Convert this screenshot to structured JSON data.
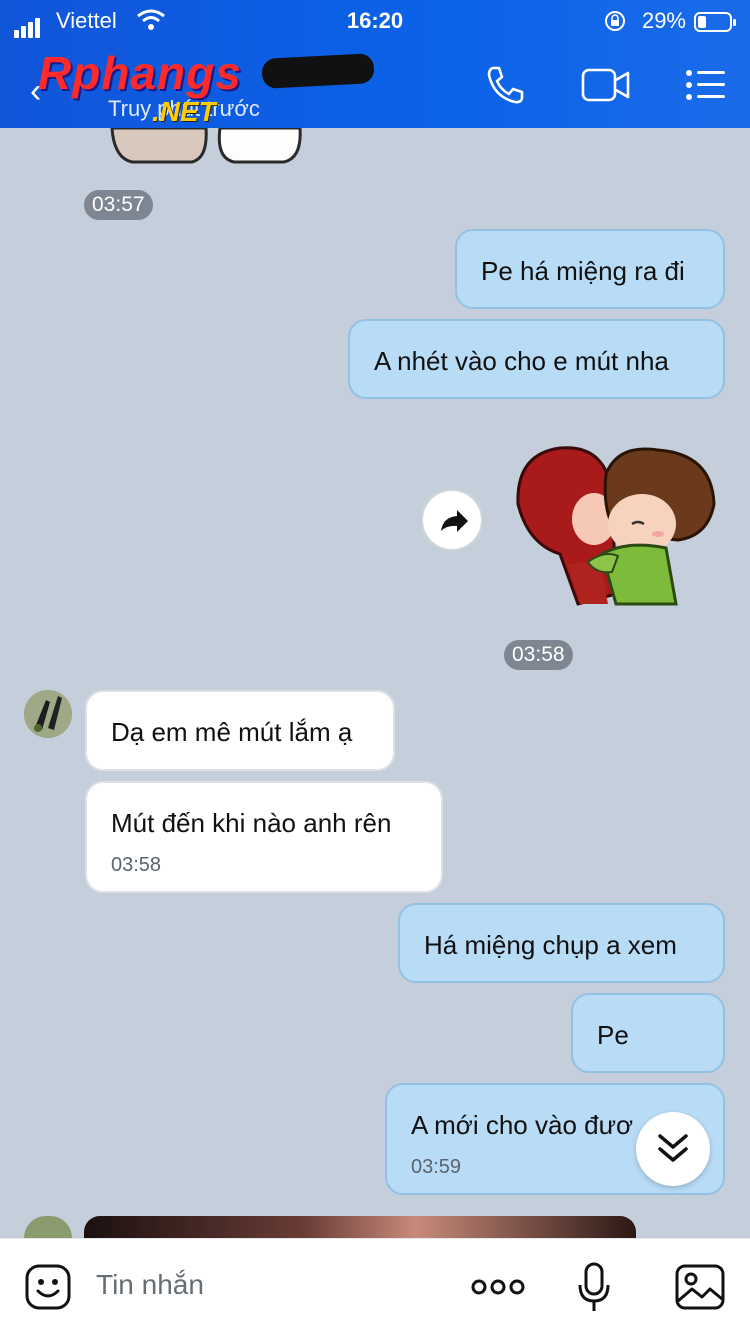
{
  "status_bar": {
    "carrier": "Viettel",
    "time": "16:20",
    "battery_percent": "29%"
  },
  "header": {
    "back_icon": "chevron-left-icon",
    "logo_text": "Rphangs",
    "logo_subtext": ".NET",
    "subtitle": "Truy      phút trước",
    "call_icon": "phone-icon",
    "video_icon": "video-camera-icon",
    "menu_icon": "list-menu-icon"
  },
  "messages": {
    "time_1": "03:57",
    "out_1": "Pe há miệng ra đi",
    "out_2": "A nhét vào cho e mút nha",
    "time_2": "03:58",
    "in_1": "Dạ em mê mút lắm ạ",
    "in_2": "Mút đến khi nào anh rên",
    "in_2_time": "03:58",
    "out_3": "Há miệng chụp a xem",
    "out_4": "Pe",
    "out_5": "A mới cho vào đươ",
    "out_5_time": "03:59"
  },
  "input_bar": {
    "placeholder": "Tin nhắn",
    "emoji_icon": "emoji-icon",
    "more_icon": "more-dots-icon",
    "mic_icon": "microphone-icon",
    "image_icon": "image-icon"
  },
  "colors": {
    "header_blue": "#0b63e8",
    "outgoing_bubble": "#b8dcf6",
    "incoming_bubble": "#ffffff",
    "chat_background": "#c5cedb"
  }
}
